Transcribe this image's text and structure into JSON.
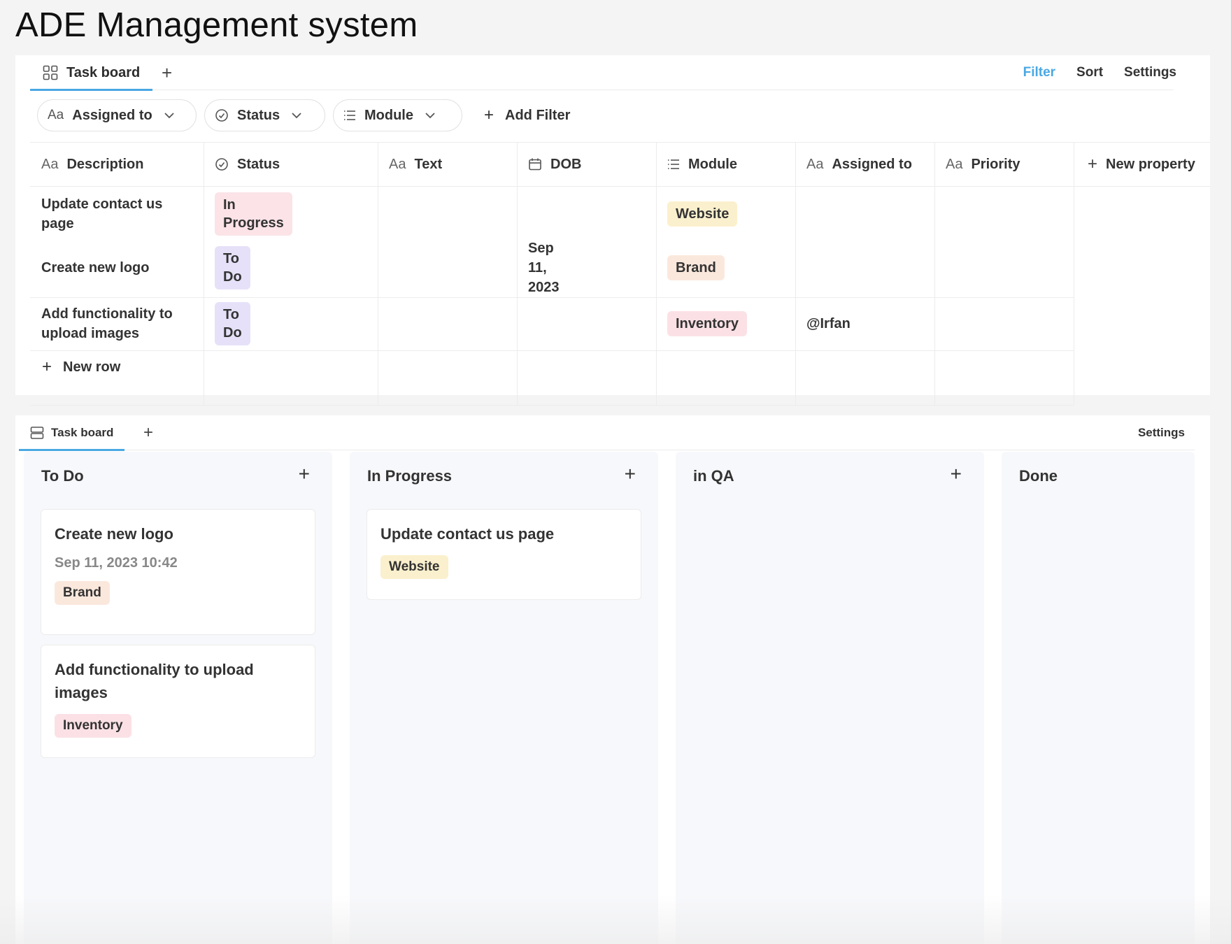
{
  "app": {
    "title": "ADE Management system"
  },
  "table_view": {
    "tabs": [
      {
        "label": "Task board",
        "icon": "grid-icon"
      }
    ],
    "actions": {
      "filter": "Filter",
      "sort": "Sort",
      "settings": "Settings"
    },
    "filters": [
      {
        "icon": "Aa",
        "label": "Assigned to"
      },
      {
        "icon": "status-circle-icon",
        "label": "Status"
      },
      {
        "icon": "list-icon",
        "label": "Module"
      }
    ],
    "add_filter": "Add Filter",
    "columns": [
      {
        "icon": "Aa",
        "label": "Description"
      },
      {
        "icon": "status-circle-icon",
        "label": "Status"
      },
      {
        "icon": "Aa",
        "label": "Text"
      },
      {
        "icon": "calendar-icon",
        "label": "DOB"
      },
      {
        "icon": "list-icon",
        "label": "Module"
      },
      {
        "icon": "Aa",
        "label": "Assigned to"
      },
      {
        "icon": "Aa",
        "label": "Priority"
      }
    ],
    "new_property": "New property",
    "rows": [
      {
        "description": "Update contact us page",
        "status": "In Progress",
        "text": "",
        "dob": "",
        "module": "Website",
        "assigned_to": "",
        "priority": ""
      },
      {
        "description": "Create new logo",
        "status": "To Do",
        "text": "",
        "dob": "Sep 11, 2023",
        "module": "Brand",
        "assigned_to": "",
        "priority": ""
      },
      {
        "description": "Add functionality to upload images",
        "status": "To Do",
        "text": "",
        "dob": "",
        "module": "Inventory",
        "assigned_to": "@Irfan",
        "priority": ""
      }
    ],
    "new_row": "New row"
  },
  "board_view": {
    "tabs": [
      {
        "label": "Task board",
        "icon": "board-icon"
      }
    ],
    "settings": "Settings",
    "columns": [
      {
        "title": "To Do",
        "cards": [
          {
            "title": "Create new logo",
            "date": "Sep 11, 2023 10:42",
            "tag": "Brand"
          },
          {
            "title": "Add functionality to upload images",
            "date": "",
            "tag": "Inventory"
          }
        ]
      },
      {
        "title": "In Progress",
        "cards": [
          {
            "title": "Update contact us page",
            "date": "",
            "tag": "Website"
          }
        ]
      },
      {
        "title": "in QA",
        "cards": []
      },
      {
        "title": "Done",
        "cards": []
      }
    ]
  },
  "colors": {
    "accent": "#4aa8e3",
    "todo": "#e6e1f8",
    "in_progress": "#fbe3e8",
    "website": "#fbf0cd",
    "brand": "#fbe8dd",
    "inventory": "#fbe1e6"
  }
}
